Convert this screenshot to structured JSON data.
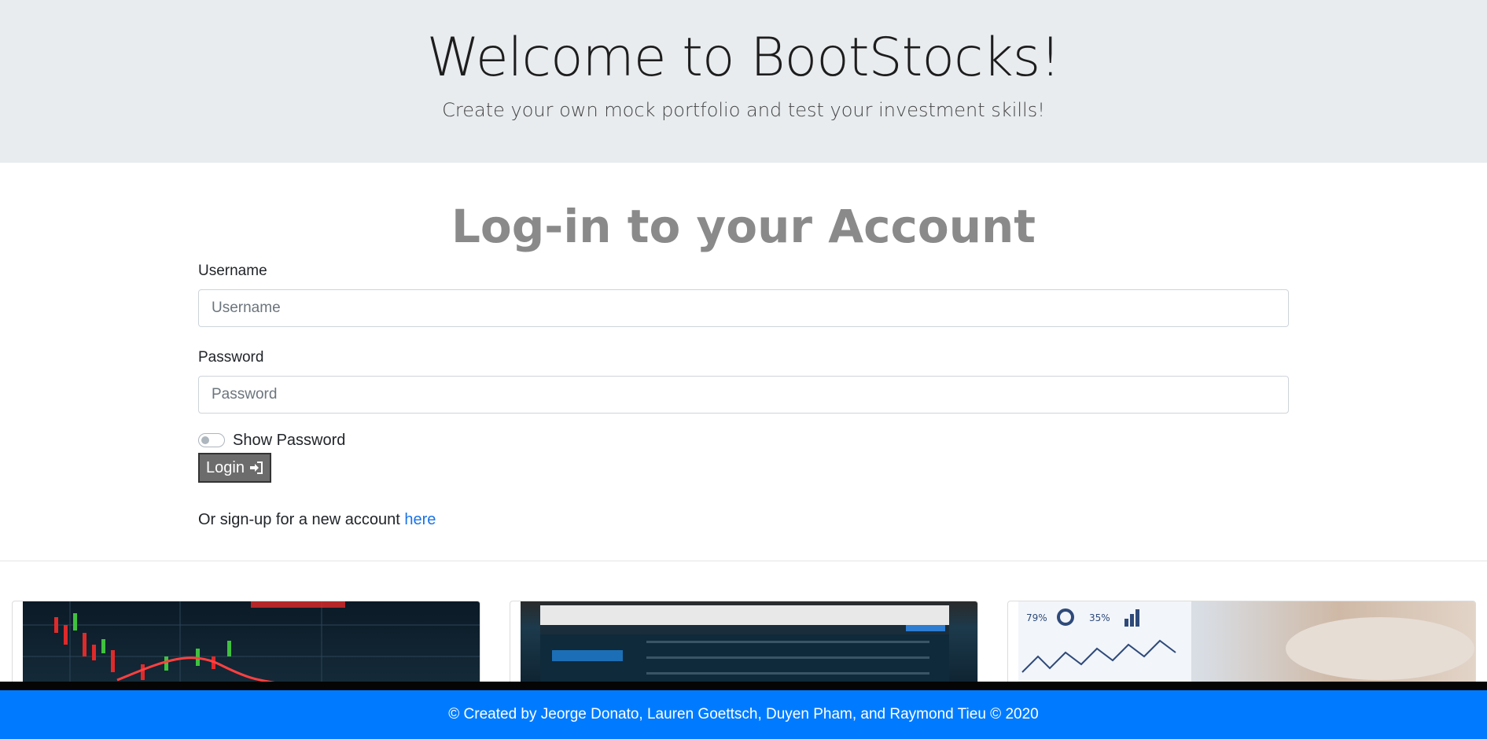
{
  "header": {
    "title": "Welcome to BootStocks!",
    "subtitle": "Create your own mock portfolio and test your investment skills!"
  },
  "login": {
    "heading": "Log-in to your Account",
    "username_label": "Username",
    "username_placeholder": "Username",
    "username_value": "",
    "password_label": "Password",
    "password_placeholder": "Password",
    "password_value": "",
    "show_password_label": "Show Password",
    "show_password_checked": false,
    "login_button_label": "Login",
    "login_icon": "sign-in-icon",
    "signup_text": "Or sign-up for a new account",
    "signup_link": "here"
  },
  "cards": [
    {
      "image": "stock-candlestick-chart-photo"
    },
    {
      "image": "laptop-trading-screen-photo"
    },
    {
      "image": "financial-report-charts-photo"
    }
  ],
  "footer": {
    "text": "© Created by Jeorge Donato, Lauren Goettsch, Duyen Pham, and Raymond Tieu © 2020"
  },
  "colors": {
    "jumbotron_bg": "#e9ecef",
    "heading_gray": "#8a8a8a",
    "link_blue": "#1a73e8",
    "footer_bg": "#007bff",
    "button_bg": "#6c6c6c"
  }
}
